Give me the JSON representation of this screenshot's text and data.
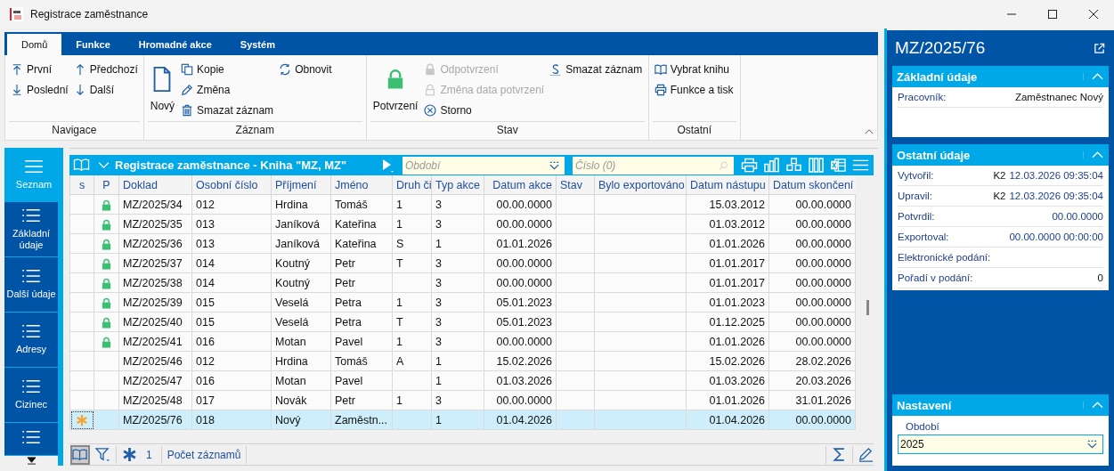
{
  "window": {
    "title": "Registrace zaměstnance"
  },
  "ribbon": {
    "tabs": [
      {
        "label": "Domů",
        "selected": true
      },
      {
        "label": "Funkce",
        "selected": false
      },
      {
        "label": "Hromadné akce",
        "selected": false
      },
      {
        "label": "Systém",
        "selected": false
      }
    ],
    "groups": [
      {
        "label": "Navigace",
        "columns": [
          [
            {
              "label": "První",
              "kind": "first",
              "large": false,
              "disabled": false
            },
            {
              "label": "Poslední",
              "kind": "last",
              "large": false,
              "disabled": false
            }
          ],
          [
            {
              "label": "Předchozí",
              "kind": "prev",
              "large": false,
              "disabled": false
            },
            {
              "label": "Další",
              "kind": "next",
              "large": false,
              "disabled": false
            }
          ]
        ]
      },
      {
        "label": "Záznam",
        "columns": [
          [
            {
              "label": "Nový",
              "kind": "new",
              "large": true,
              "disabled": false
            }
          ],
          [
            {
              "label": "Kopie",
              "kind": "copy",
              "large": false,
              "disabled": false
            },
            {
              "label": "Změna",
              "kind": "edit",
              "large": false,
              "disabled": false
            },
            {
              "label": "Smazat záznam",
              "kind": "delete",
              "large": false,
              "disabled": false
            }
          ],
          [
            {
              "label": "Obnovit",
              "kind": "refresh",
              "large": false,
              "disabled": false
            }
          ]
        ]
      },
      {
        "label": "Stav",
        "columns": [
          [
            {
              "label": "Potvrzení",
              "kind": "lock",
              "large": true,
              "disabled": false
            }
          ],
          [
            {
              "label": "Odpotvrzení",
              "kind": "lock",
              "large": false,
              "disabled": true
            },
            {
              "label": "Změna data potvrzení",
              "kind": "unlock",
              "large": false,
              "disabled": true
            },
            {
              "label": "Storno",
              "kind": "cancel",
              "large": false,
              "disabled": false
            }
          ],
          [
            {
              "label": "Smazat záznam",
              "kind": "sign",
              "large": false,
              "disabled": false
            }
          ]
        ]
      },
      {
        "label": "Ostatní",
        "columns": [
          [
            {
              "label": "Vybrat knihu",
              "kind": "book",
              "large": false,
              "disabled": false
            },
            {
              "label": "Funkce a tisk",
              "kind": "print",
              "large": false,
              "disabled": false
            }
          ]
        ]
      }
    ]
  },
  "nav": {
    "items": [
      {
        "label": "Seznam",
        "selected": true
      },
      {
        "label": "Základní údaje",
        "selected": false
      },
      {
        "label": "Další údaje",
        "selected": false
      },
      {
        "label": "Adresy",
        "selected": false
      },
      {
        "label": "Cizinec",
        "selected": false
      }
    ]
  },
  "grid": {
    "title": "Registrace zaměstnance - Kniha \"MZ, MZ\"",
    "period": {
      "placeholder": "Období"
    },
    "number": {
      "placeholder": "Číslo (0)"
    },
    "columns": [
      {
        "label": "s",
        "kind": "new"
      },
      {
        "label": "P",
        "kind": "lock"
      },
      {
        "label": "Doklad",
        "kind": "text"
      },
      {
        "label": "Osobní číslo",
        "kind": "text"
      },
      {
        "label": "Příjmení",
        "kind": "text"
      },
      {
        "label": "Jméno",
        "kind": "text"
      },
      {
        "label": "Druh či",
        "kind": "text"
      },
      {
        "label": "Typ akce",
        "kind": "text"
      },
      {
        "label": "Datum akce",
        "kind": "date"
      },
      {
        "label": "Stav",
        "kind": "text"
      },
      {
        "label": "Bylo exportováno",
        "kind": "text"
      },
      {
        "label": "Datum nástupu",
        "kind": "date"
      },
      {
        "label": "Datum skončení",
        "kind": "date"
      }
    ],
    "rows": [
      {
        "locked": true,
        "new": false,
        "selected": false,
        "cells": [
          "",
          "",
          "MZ/2025/34",
          "012",
          "Hrdina",
          "Tomáš",
          "1",
          "3",
          "00.00.0000",
          "",
          "",
          "15.03.2012",
          "00.00.0000"
        ]
      },
      {
        "locked": true,
        "new": false,
        "selected": false,
        "cells": [
          "",
          "",
          "MZ/2025/35",
          "013",
          "Janíková",
          "Kateřina",
          "1",
          "3",
          "00.00.0000",
          "",
          "",
          "01.03.2012",
          "00.00.0000"
        ]
      },
      {
        "locked": true,
        "new": false,
        "selected": false,
        "cells": [
          "",
          "",
          "MZ/2025/36",
          "013",
          "Janíková",
          "Kateřina",
          "S",
          "1",
          "01.01.2026",
          "",
          "",
          "01.01.2026",
          "00.00.0000"
        ]
      },
      {
        "locked": true,
        "new": false,
        "selected": false,
        "cells": [
          "",
          "",
          "MZ/2025/37",
          "014",
          "Koutný",
          "Petr",
          "T",
          "3",
          "00.00.0000",
          "",
          "",
          "01.01.2017",
          "00.00.0000"
        ]
      },
      {
        "locked": true,
        "new": false,
        "selected": false,
        "cells": [
          "",
          "",
          "MZ/2025/38",
          "014",
          "Koutný",
          "Petr",
          "",
          "3",
          "00.00.0000",
          "",
          "",
          "01.01.2017",
          "00.00.0000"
        ]
      },
      {
        "locked": true,
        "new": false,
        "selected": false,
        "cells": [
          "",
          "",
          "MZ/2025/39",
          "015",
          "Veselá",
          "Petra",
          "1",
          "3",
          "05.01.2023",
          "",
          "",
          "01.01.2023",
          "00.00.0000"
        ]
      },
      {
        "locked": true,
        "new": false,
        "selected": false,
        "cells": [
          "",
          "",
          "MZ/2025/40",
          "015",
          "Veselá",
          "Petra",
          "T",
          "3",
          "05.01.2023",
          "",
          "",
          "01.12.2025",
          "00.00.0000"
        ]
      },
      {
        "locked": true,
        "new": false,
        "selected": false,
        "cells": [
          "",
          "",
          "MZ/2025/41",
          "016",
          "Motan",
          "Pavel",
          "1",
          "3",
          "00.00.0000",
          "",
          "",
          "01.01.2026",
          "00.00.0000"
        ]
      },
      {
        "locked": false,
        "new": false,
        "selected": false,
        "cells": [
          "",
          "",
          "MZ/2025/46",
          "012",
          "Hrdina",
          "Tomáš",
          "A",
          "1",
          "15.02.2026",
          "",
          "",
          "15.02.2026",
          "28.02.2026"
        ]
      },
      {
        "locked": false,
        "new": false,
        "selected": false,
        "cells": [
          "",
          "",
          "MZ/2025/47",
          "016",
          "Motan",
          "Pavel",
          "",
          "1",
          "01.03.2026",
          "",
          "",
          "01.03.2026",
          "20.03.2026"
        ]
      },
      {
        "locked": false,
        "new": false,
        "selected": false,
        "cells": [
          "",
          "",
          "MZ/2025/48",
          "017",
          "Novák",
          "Petr",
          "1",
          "3",
          "00.00.0000",
          "",
          "",
          "01.01.2026",
          "31.01.2026"
        ]
      },
      {
        "locked": false,
        "new": true,
        "selected": true,
        "cells": [
          "",
          "",
          "MZ/2025/76",
          "018",
          "Nový",
          "Zaměstn...",
          "",
          "1",
          "01.04.2026",
          "",
          "",
          "01.04.2026",
          "00.00.0000"
        ]
      }
    ]
  },
  "footer": {
    "count": "1",
    "label": "Počet záznamů"
  },
  "detail": {
    "title": "MZ/2025/76",
    "sections": [
      {
        "title": "Základní údaje",
        "expanded": true,
        "fields": [
          {
            "label": "Pracovník:",
            "value": "Zaměstnanec Nový",
            "kind": "text"
          }
        ]
      },
      {
        "title": "Ostatní údaje",
        "expanded": true,
        "fields": [
          {
            "label": "Vytvořil:",
            "user": "K2",
            "value": "12.03.2026 09:35:04",
            "kind": "date"
          },
          {
            "label": "Upravil:",
            "user": "K2",
            "value": "12.03.2026 09:35:04",
            "kind": "date"
          },
          {
            "label": "Potvrdil:",
            "value": "00.00.0000",
            "kind": "date"
          },
          {
            "label": "Exportoval:",
            "value": "00.00.0000 00:00:00",
            "kind": "date"
          },
          {
            "label": "Elektronické podání:"
          },
          {
            "label": "Pořadí v podání:",
            "value": "0",
            "kind": "text"
          }
        ]
      },
      {
        "title": "Nastavení",
        "expanded": true,
        "period": {
          "label": "Období",
          "value": "2025"
        }
      }
    ]
  }
}
